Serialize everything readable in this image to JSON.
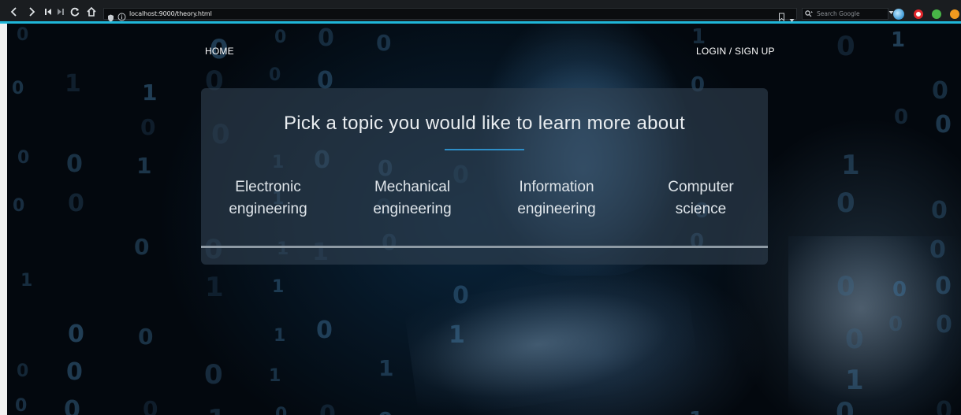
{
  "browser": {
    "url": "localhost:9000/theory.html",
    "search_placeholder": "Search Google",
    "accent_color": "#1fb6d8",
    "nav_icons": [
      "back-icon",
      "forward-icon",
      "first-icon",
      "last-icon",
      "reload-icon",
      "home-icon"
    ],
    "extension_icons": [
      "globe-icon",
      "opera-icon",
      "circle-icon",
      "addon-icon"
    ]
  },
  "header": {
    "home_label": "HOME",
    "login_label": "LOGIN / SIGN UP"
  },
  "panel": {
    "title": "Pick a topic you would like to learn more about",
    "accent_color": "#2d8ec7",
    "topics": [
      {
        "line1": "Electronic",
        "line2": "engineering"
      },
      {
        "line1": "Mechanical",
        "line2": "engineering"
      },
      {
        "line1": "Information",
        "line2": "engineering"
      },
      {
        "line1": "Computer",
        "line2": "science"
      }
    ]
  }
}
